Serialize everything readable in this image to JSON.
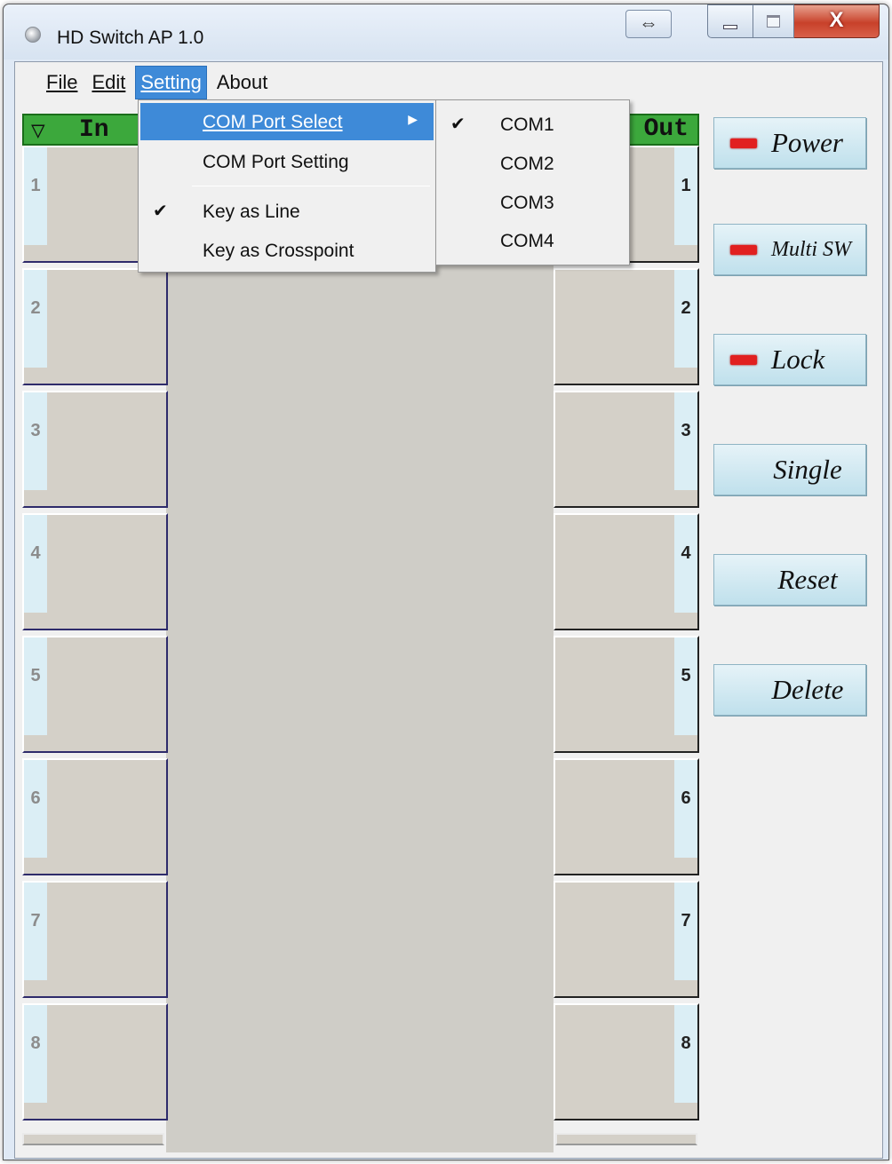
{
  "window": {
    "title": "HD Switch AP 1.0",
    "resize_glyph": "⇔",
    "close_glyph": "X"
  },
  "menubar": {
    "items": [
      {
        "label": "File"
      },
      {
        "label": "Edit"
      },
      {
        "label": "Setting"
      },
      {
        "label": "About"
      }
    ]
  },
  "setting_menu": {
    "items": [
      {
        "label": "COM Port Select",
        "checked": false,
        "submenu": true
      },
      {
        "label": "COM Port Setting",
        "checked": false
      },
      {
        "label": "Key as Line",
        "checked": true
      },
      {
        "label": "Key as Crosspoint",
        "checked": false
      }
    ]
  },
  "com_menu": {
    "items": [
      {
        "label": "COM1",
        "checked": true
      },
      {
        "label": "COM2",
        "checked": false
      },
      {
        "label": "COM3",
        "checked": false
      },
      {
        "label": "COM4",
        "checked": false
      }
    ]
  },
  "matrix": {
    "in_header": "In",
    "out_header": "Out",
    "inputs": [
      "1",
      "2",
      "3",
      "4",
      "5",
      "6",
      "7",
      "8"
    ],
    "outputs": [
      "1",
      "2",
      "3",
      "4",
      "5",
      "6",
      "7",
      "8"
    ]
  },
  "side_buttons": [
    {
      "label": "Power",
      "led": true
    },
    {
      "label": "Multi SW",
      "led": true
    },
    {
      "label": "Lock",
      "led": true
    },
    {
      "label": "Single",
      "led": false
    },
    {
      "label": "Reset",
      "led": false
    },
    {
      "label": "Delete",
      "led": false
    }
  ],
  "colors": {
    "header_green": "#3ca83c",
    "led_red": "#e12020",
    "menu_highlight": "#3e8ad8"
  }
}
